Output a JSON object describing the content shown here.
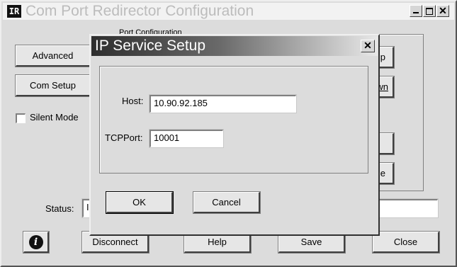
{
  "main_window": {
    "title": "Com Port Redirector Configuration",
    "logo_text": "IR",
    "advanced_label": "Advanced",
    "com_setup_label": "Com Setup",
    "silent_mode_label": "Silent Mode",
    "silent_mode_checked": false,
    "group_title": "Port Configuration",
    "right_button_1": "p",
    "right_button_2": "wn",
    "right_button_4": "e",
    "status_label": "Status:",
    "status_value": "Id",
    "disconnect_label": "Disconnect",
    "help_label": "Help",
    "save_label": "Save",
    "close_label": "Close"
  },
  "dialog": {
    "title": "IP Service Setup",
    "host_label": "Host:",
    "host_value": "10.90.92.185",
    "tcpport_label": "TCPPort:",
    "tcpport_value": "10001",
    "ok_label": "OK",
    "cancel_label": "Cancel"
  },
  "colors": {
    "title_active_gradient": [
      "#2e2e2e",
      "#e8e8e8"
    ],
    "title_inactive": "#bcbcbc"
  }
}
